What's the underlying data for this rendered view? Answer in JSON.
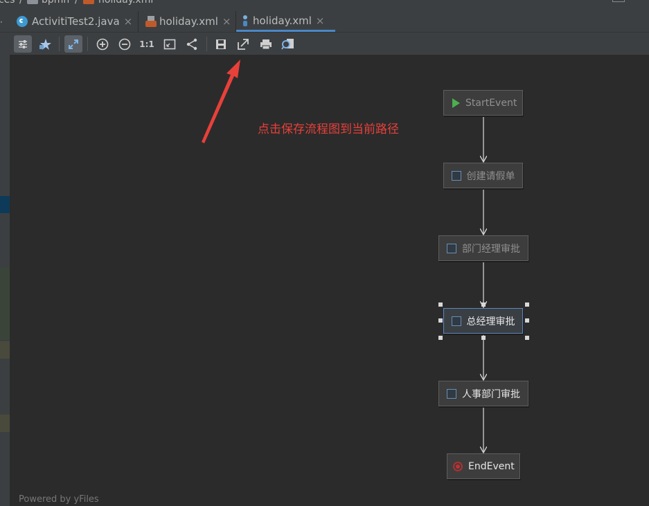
{
  "breadcrumb": {
    "part1": "ces",
    "sep": "/",
    "part2": "bpmn",
    "part3": "holiday.xml"
  },
  "tabs": [
    {
      "label": "ActivitiTest2.java",
      "close": "×",
      "icon": "java-class-icon"
    },
    {
      "label": "holiday.xml",
      "close": "×",
      "icon": "xml-file-icon"
    },
    {
      "label": "holiday.xml",
      "close": "×",
      "icon": "bpmn-file-icon",
      "active": true
    }
  ],
  "toolbar": {
    "actual_size_label": "1:1",
    "buttons": [
      "properties-icon",
      "favorite-icon",
      "fit-selection-icon",
      "zoom-in-icon",
      "zoom-out-icon",
      "actual-size-icon",
      "fit-content-icon",
      "layout-icon",
      "save-icon",
      "export-icon",
      "print-icon",
      "print-preview-icon"
    ]
  },
  "annotation": {
    "text": "点击保存流程图到当前路径",
    "color": "#e8403a"
  },
  "diagram": {
    "nodes": [
      {
        "label": "StartEvent",
        "kind": "start-event"
      },
      {
        "label": "创建请假单",
        "kind": "user-task"
      },
      {
        "label": "部门经理审批",
        "kind": "user-task"
      },
      {
        "label": "总经理审批",
        "kind": "user-task",
        "selected": true
      },
      {
        "label": "人事部门审批",
        "kind": "user-task"
      },
      {
        "label": "EndEvent",
        "kind": "end-event"
      }
    ]
  },
  "watermark": "Powered by yFiles",
  "colors": {
    "background": "#2b2b2b",
    "panel": "#3c3f41",
    "accent": "#4a88c7",
    "arrow": "#e8403a"
  }
}
